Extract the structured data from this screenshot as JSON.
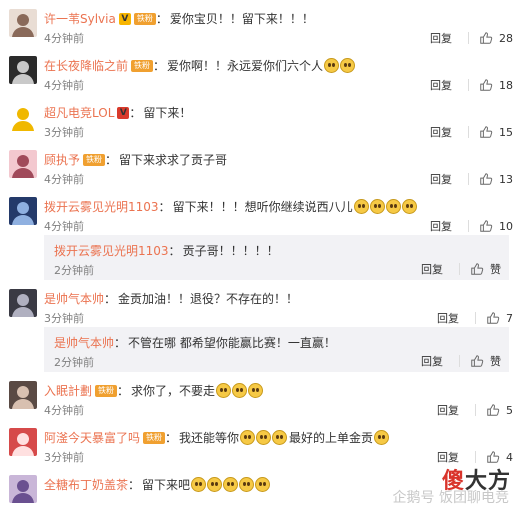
{
  "comments": [
    {
      "user": "许一苇Sylvia",
      "vip": "V",
      "vip_color": "#f7b500",
      "badge": "铁粉",
      "text": "爱你宝贝！！留下来！！！",
      "emojis": 0,
      "time": "4分钟前",
      "reply_label": "回复",
      "likes": "28",
      "avatar": {
        "bg": "#e9ddd4",
        "fg": "#8a6a5a"
      }
    },
    {
      "user": "在长夜降临之前",
      "vip": "",
      "badge": "铁粉",
      "text": "爱你啊！！永远爱你们六个人",
      "emojis": 2,
      "time": "4分钟前",
      "reply_label": "回复",
      "likes": "18",
      "avatar": {
        "bg": "#2b2b2b",
        "fg": "#c9c9c9"
      }
    },
    {
      "user": "超凡电竞LOL",
      "vip": "V",
      "vip_color": "#d93a2b",
      "badge": "",
      "text": "留下来！",
      "emojis": 0,
      "time": "3分钟前",
      "reply_label": "回复",
      "likes": "15",
      "avatar": {
        "bg": "#ffffff",
        "fg": "#f0b800"
      }
    },
    {
      "user": "顾执予",
      "vip": "",
      "badge": "铁粉",
      "text": "留下来求求了贡子哥",
      "emojis": 0,
      "time": "4分钟前",
      "reply_label": "回复",
      "likes": "13",
      "avatar": {
        "bg": "#f3c8cf",
        "fg": "#a04a5a"
      }
    },
    {
      "user": "拨开云雾见光明1103",
      "vip": "",
      "badge": "",
      "text": "留下来！！！想听你继续说西八儿",
      "emojis": 4,
      "time": "4分钟前",
      "reply_label": "回复",
      "likes": "10",
      "avatar": {
        "bg": "#243a6a",
        "fg": "#8fb0e0"
      },
      "reply": {
        "user": "拨开云雾见光明1103",
        "text": "贡子哥！！！！！",
        "emojis": 0,
        "time": "2分钟前",
        "reply_label": "回复",
        "like_label": "赞"
      }
    },
    {
      "user": "是帅气本帅",
      "vip": "",
      "badge": "",
      "text": "金贡加油！！退役？不存在的！！",
      "emojis": 0,
      "time": "3分钟前",
      "reply_label": "回复",
      "likes": "7",
      "avatar": {
        "bg": "#3a3a44",
        "fg": "#b0b0c0"
      },
      "reply": {
        "user": "是帅气本帅",
        "text": "不管在哪 都希望你能赢比赛！一直赢！",
        "emojis": 0,
        "time": "2分钟前",
        "reply_label": "回复",
        "like_label": "赞"
      }
    },
    {
      "user": "入眠計劃",
      "vip": "",
      "badge": "铁粉",
      "text": "求你了，不要走",
      "emojis": 3,
      "time": "4分钟前",
      "reply_label": "回复",
      "likes": "5",
      "avatar": {
        "bg": "#5a4a44",
        "fg": "#d8c0b0"
      }
    },
    {
      "user": "阿滏今天暴富了吗",
      "vip": "",
      "badge": "铁粉",
      "text": "我还能等你",
      "emojis": 3,
      "text2": "最好的上单金贡",
      "emojis2": 1,
      "time": "3分钟前",
      "reply_label": "回复",
      "likes": "4",
      "avatar": {
        "bg": "#d64a4a",
        "fg": "#ffe0e0"
      }
    },
    {
      "user": "全糖布丁奶盖茶",
      "vip": "",
      "badge": "",
      "text": "留下来吧",
      "emojis": 5,
      "time": "",
      "reply_label": "",
      "likes": "",
      "avatar": {
        "bg": "#c9b6d8",
        "fg": "#6a5090"
      }
    }
  ],
  "watermark": {
    "brand_part1": "傻",
    "brand_part2": "大方",
    "source": "企鹅号 饭团聊电竞"
  },
  "colors": {
    "username": "#eb7350",
    "badge": "#f0a030"
  }
}
